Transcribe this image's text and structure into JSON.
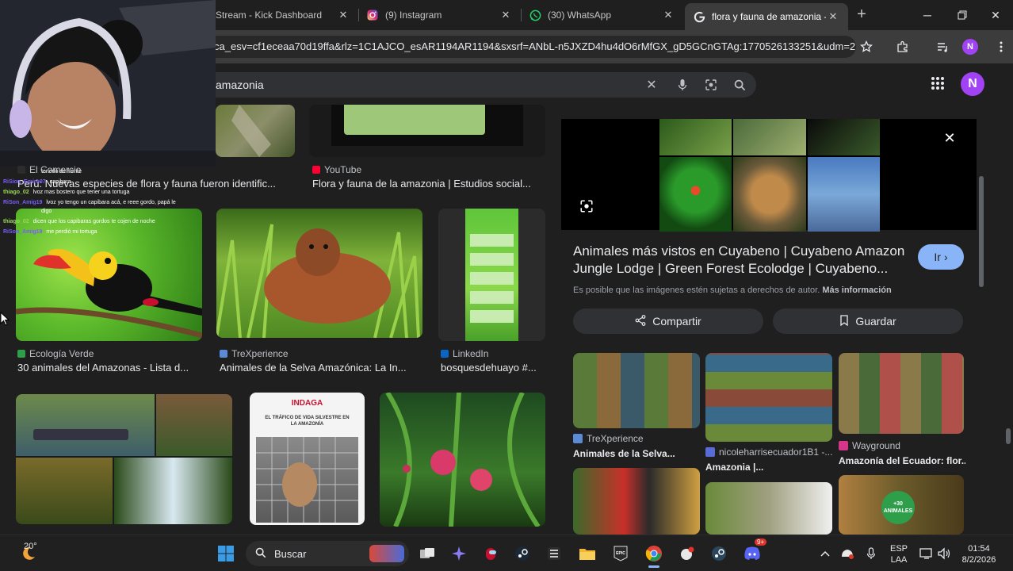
{
  "tabs": [
    {
      "label": "Stream - Kick Dashboard",
      "icon": "kick-icon"
    },
    {
      "label": "(9) Instagram",
      "icon": "instagram-icon"
    },
    {
      "label": "(30) WhatsApp",
      "icon": "whatsapp-icon"
    },
    {
      "label": "flora y fauna de amazonia -",
      "icon": "google-icon"
    }
  ],
  "address": {
    "url": "ca_esv=cf1eceaa70d19ffa&rlz=1C1AJCO_esAR1194AR1194&sxsrf=ANbL-n5JXZD4hu4dO6rMfGX_gD5GCnGTAg:1770526133251&udm=2..."
  },
  "profile_initial": "N",
  "search": {
    "query": "amazonia"
  },
  "results": {
    "top_row": [
      {
        "source": "El Comercio",
        "caption": "Perú: Nuevas especies de flora y fauna fueron identific..."
      },
      {
        "source": "YouTube",
        "caption": "Flora y fauna de la amazonia | Estudios social..."
      }
    ],
    "middle_row": [
      {
        "source": "Ecología Verde",
        "caption": "30 animales del Amazonas - Lista d..."
      },
      {
        "source": "TreXperience",
        "caption": "Animales de la Selva Amazónica: La In..."
      },
      {
        "source": "LinkedIn",
        "caption": "bosquesdehuayo #..."
      }
    ],
    "bottom_row_texts": [
      "INDAGA",
      "EL TRÁFICO DE VIDA SILVESTRE EN LA AMAZONÍA"
    ]
  },
  "panel": {
    "title": "Animales más vistos en Cuyabeno | Cuyabeno Amazon Jungle Lodge | Green Forest Ecolodge | Cuyabeno...",
    "open_label": "Ir",
    "copyright_note": "Es posible que las imágenes estén sujetas a derechos de autor.",
    "more_info": "Más información",
    "share_label": "Compartir",
    "save_label": "Guardar",
    "related": [
      {
        "source": "TreXperience",
        "caption": "Animales de la Selva..."
      },
      {
        "source": "nicoleharrisecuador1B1 -...",
        "caption": "Amazonia |..."
      },
      {
        "source": "Wayground",
        "caption": "Amazonía del Ecuador: flor..."
      }
    ],
    "badge_text": "+30 ANIMALES"
  },
  "chat": [
    {
      "user": "",
      "text": "tenerlo de frente"
    },
    {
      "user": "RiSion_Emiro07",
      "text": "capibara"
    },
    {
      "user": "thiago_02",
      "text": "lvoz mas bostero que tener una tortuga"
    },
    {
      "user": "RiSon_Amig19",
      "text": "lvoz yo tengo un capibara acá, e reee gordo, papá le"
    },
    {
      "user": "",
      "text": "digo"
    },
    {
      "user": "thiago_02",
      "text": "dicen que los capibaras gordos te cojen de noche"
    },
    {
      "user": "RiSon_Amig19",
      "text": "me perdió mi tortuga"
    }
  ],
  "taskbar": {
    "weather_temp": "20°",
    "search_label": "Buscar",
    "lang_top": "ESP",
    "lang_bottom": "LAA",
    "time": "01:54",
    "date": "8/2/2026",
    "discord_badge": "9+"
  },
  "colors": {
    "accent_blue": "#8ab4f8",
    "avatar_purple": "#a142f4",
    "bg_dark": "#1f1f1f"
  }
}
